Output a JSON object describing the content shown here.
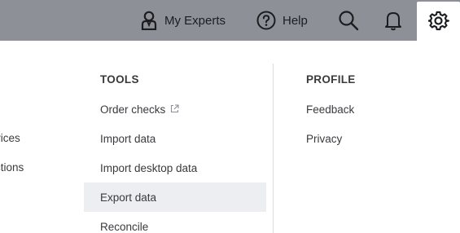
{
  "topbar": {
    "my_experts_label": "My Experts",
    "help_label": "Help"
  },
  "left_column": {
    "items": [
      "vices",
      "ctions"
    ]
  },
  "tools": {
    "heading": "TOOLS",
    "items": [
      {
        "label": "Order checks",
        "external": true
      },
      {
        "label": "Import data"
      },
      {
        "label": "Import desktop data"
      },
      {
        "label": "Export data",
        "active": true
      },
      {
        "label": "Reconcile"
      }
    ]
  },
  "profile": {
    "heading": "PROFILE",
    "items": [
      {
        "label": "Feedback"
      },
      {
        "label": "Privacy"
      }
    ]
  },
  "colors": {
    "topbar_bg": "#8d9096",
    "panel_bg": "#ffffff",
    "active_row_bg": "#eceef1",
    "text": "#393a3d"
  }
}
